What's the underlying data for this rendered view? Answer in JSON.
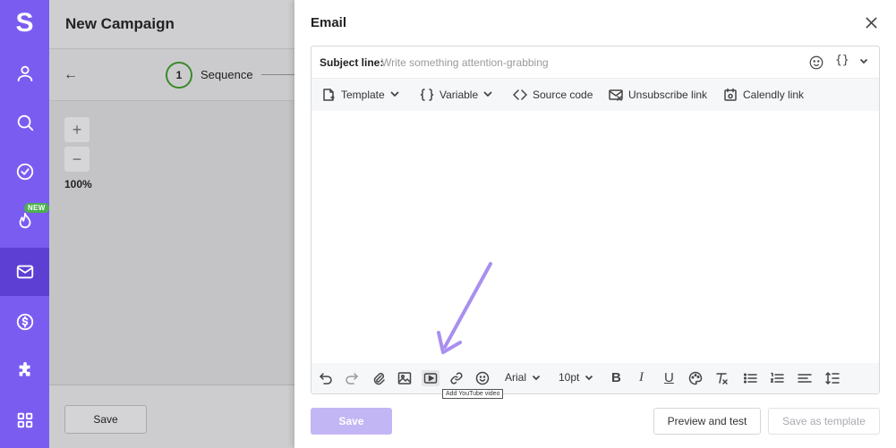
{
  "sidebar": {
    "logo": "S",
    "new_badge": "NEW",
    "items": [
      {
        "icon": "user-icon"
      },
      {
        "icon": "search-icon"
      },
      {
        "icon": "check-circle-icon"
      },
      {
        "icon": "flame-icon"
      },
      {
        "icon": "mail-icon"
      },
      {
        "icon": "dollar-icon"
      },
      {
        "icon": "puzzle-icon"
      },
      {
        "icon": "grid-icon"
      }
    ],
    "accent_color": "#7b5cf0",
    "active_color": "#5d3fd3"
  },
  "campaign": {
    "title": "New Campaign",
    "back_icon": "←",
    "step_number": "1",
    "step_label": "Sequence",
    "zoom_in": "+",
    "zoom_out": "−",
    "zoom_level": "100%",
    "save_label": "Save"
  },
  "email": {
    "title": "Email",
    "subject_label": "Subject line:",
    "subject_placeholder": "Write something attention-grabbing",
    "subject_variable": "{}",
    "toolbar": {
      "template": "Template",
      "variable": "Variable",
      "source_code": "Source code",
      "unsubscribe": "Unsubscribe link",
      "calendly": "Calendly link"
    },
    "format": {
      "font": "Arial",
      "size": "10pt",
      "bold": "B",
      "italic": "I",
      "underline": "U"
    },
    "tooltip": "Add YouTube video",
    "save_label": "Save",
    "preview_label": "Preview and test",
    "save_template_label": "Save as template"
  }
}
